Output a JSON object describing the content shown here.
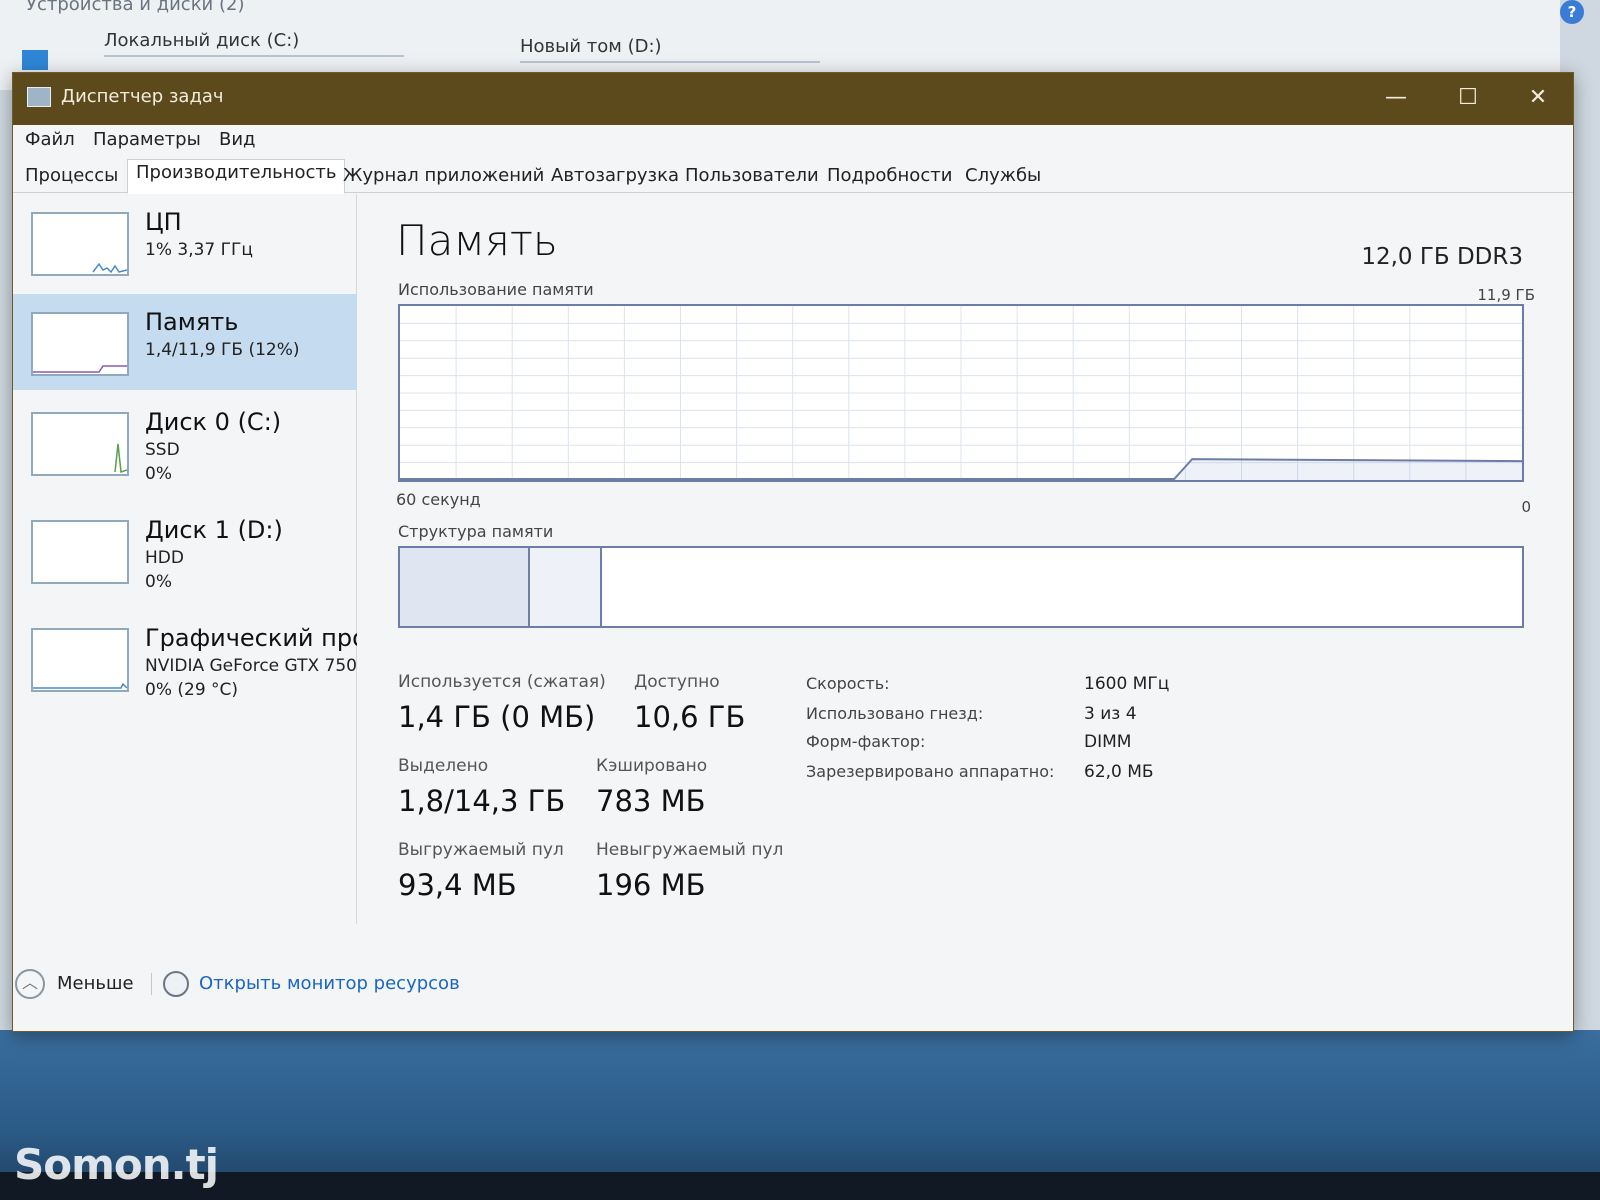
{
  "background": {
    "section_title": "Устройства и диски (2)",
    "drive_c": "Локальный диск (C:)",
    "drive_d": "Новый том (D:)",
    "help_glyph": "?"
  },
  "window": {
    "title": "Диспетчер задач",
    "controls": {
      "minimize": "—",
      "maximize": "☐",
      "close": "✕"
    }
  },
  "menu": [
    "Файл",
    "Параметры",
    "Вид"
  ],
  "tabs": [
    "Процессы",
    "Производительность",
    "Журнал приложений",
    "Автозагрузка",
    "Пользователи",
    "Подробности",
    "Службы"
  ],
  "active_tab": "Производительность",
  "sidebar": [
    {
      "name": "ЦП",
      "line1": "1% 3,37 ГГц",
      "line2": ""
    },
    {
      "name": "Память",
      "line1": "1,4/11,9 ГБ (12%)",
      "line2": ""
    },
    {
      "name": "Диск 0 (C:)",
      "line1": "SSD",
      "line2": "0%"
    },
    {
      "name": "Диск 1 (D:)",
      "line1": "HDD",
      "line2": "0%"
    },
    {
      "name": "Графический про",
      "line1": "NVIDIA GeForce GTX 750",
      "line2": "0% (29 °C)"
    }
  ],
  "memory": {
    "title": "Память",
    "type": "12,0 ГБ DDR3",
    "usage_label": "Использование памяти",
    "usage_max": "11,9 ГБ",
    "time_label": "60 секунд",
    "zero_label": "0",
    "structure_label": "Структура памяти",
    "in_use_fraction": 0.12,
    "stats": {
      "in_use_label": "Используется (сжатая)",
      "in_use_value": "1,4 ГБ (0 МБ)",
      "available_label": "Доступно",
      "available_value": "10,6 ГБ",
      "committed_label": "Выделено",
      "committed_value": "1,8/14,3 ГБ",
      "cached_label": "Кэшировано",
      "cached_value": "783 МБ",
      "paged_label": "Выгружаемый пул",
      "paged_value": "93,4 МБ",
      "nonpaged_label": "Невыгружаемый пул",
      "nonpaged_value": "196 МБ"
    },
    "props": [
      {
        "label": "Скорость:",
        "value": "1600 МГц"
      },
      {
        "label": "Использовано гнезд:",
        "value": "3 из 4"
      },
      {
        "label": "Форм-фактор:",
        "value": "DIMM"
      },
      {
        "label": "Зарезервировано аппаратно:",
        "value": "62,0 МБ"
      }
    ]
  },
  "footer": {
    "less_label": "Меньше",
    "monitor_link": "Открыть монитор ресурсов"
  },
  "watermark": "Somon.tj",
  "colors": {
    "titlebar": "#5c4a1c",
    "selected_item": "#c5dbef",
    "graph_line": "#6c7ea8",
    "link": "#1a66c2"
  }
}
